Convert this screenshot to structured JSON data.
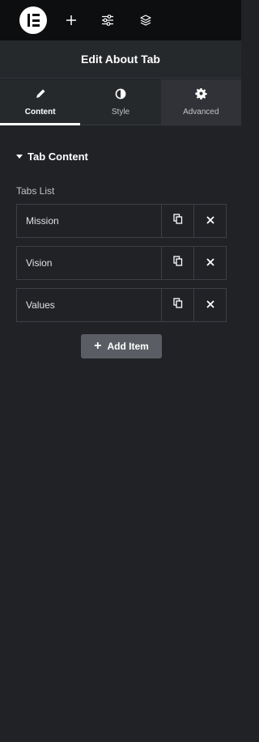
{
  "topbar": {
    "icons": [
      "elementor-logo-icon",
      "plus-icon",
      "sliders-icon",
      "layers-icon"
    ]
  },
  "header": {
    "title": "Edit About Tab"
  },
  "tabs": [
    {
      "label": "Content",
      "icon": "pencil-icon",
      "active": true
    },
    {
      "label": "Style",
      "icon": "half-circle-icon",
      "active": false
    },
    {
      "label": "Advanced",
      "icon": "gear-icon",
      "active": false
    }
  ],
  "section": {
    "title": "Tab Content",
    "expanded": true
  },
  "repeater": {
    "label": "Tabs List",
    "items": [
      {
        "title": "Mission"
      },
      {
        "title": "Vision"
      },
      {
        "title": "Values"
      }
    ],
    "add_label": "Add Item"
  },
  "colors": {
    "panel_bg": "#202226",
    "topbar_bg": "#0d0e10",
    "add_button_bg": "#5a5d64",
    "text_primary": "#ffffff"
  }
}
